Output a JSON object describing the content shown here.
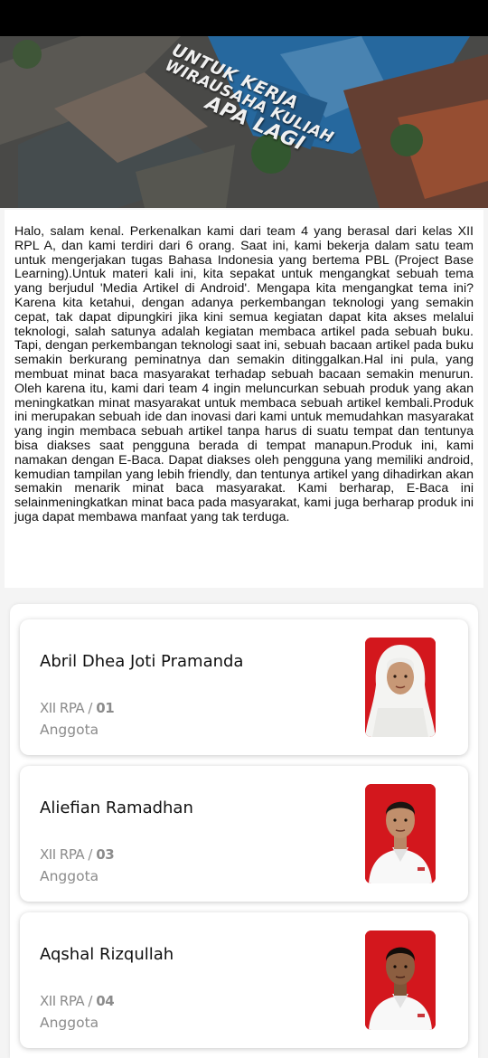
{
  "hero": {
    "line1": "UNTUK KERJA",
    "line2": "WIRAUSAHA   KULIAH",
    "line3": "APA LAGI"
  },
  "intro": {
    "text": "Halo, salam kenal. Perkenalkan kami dari team 4 yang berasal dari kelas XII RPL A, dan kami terdiri dari 6 orang. Saat ini, kami bekerja dalam satu team untuk mengerjakan tugas Bahasa Indonesia yang bertema PBL (Project Base Learning).Untuk materi kali ini, kita sepakat untuk mengangkat sebuah tema yang berjudul 'Media Artikel di Android'. Mengapa kita mengangkat tema ini? Karena kita ketahui, dengan adanya perkembangan teknologi yang semakin cepat, tak dapat dipungkiri jika kini semua kegiatan dapat kita akses melalui teknologi, salah satunya adalah kegiatan membaca artikel pada sebuah buku. Tapi, dengan perkembangan teknologi saat ini, sebuah bacaan artikel pada buku semakin berkurang peminatnya dan semakin ditinggalkan.Hal ini pula, yang membuat minat baca masyarakat terhadap sebuah bacaan semakin menurun. Oleh karena itu, kami dari team 4 ingin meluncurkan sebuah produk yang akan meningkatkan minat masyarakat untuk membaca sebuah artikel kembali.Produk ini merupakan sebuah ide dan inovasi dari kami untuk memudahkan masyarakat yang ingin membaca sebuah artikel tanpa harus di suatu tempat dan tentunya bisa diakses saat pengguna berada di tempat manapun.Produk ini, kami namakan dengan E-Baca. Dapat diakses oleh pengguna yang memiliki android, kemudian tampilan yang lebih friendly, dan tentunya artikel yang dihadirkan akan semakin menarik minat baca masyarakat. Kami berharap, E-Baca ini selainmeningkatkan minat baca pada masyarakat, kami juga berharap produk ini juga dapat membawa manfaat yang tak terduga."
  },
  "members": [
    {
      "name": "Abril Dhea Joti Pramanda",
      "class_label": "XII RPA / ",
      "number": "01",
      "role": "Anggota",
      "photo": "member-photo-hijab"
    },
    {
      "name": "Aliefian Ramadhan",
      "class_label": "XII RPA / ",
      "number": "03",
      "role": "Anggota",
      "photo": "member-photo-male"
    },
    {
      "name": "Aqshal Rizqullah",
      "class_label": "XII RPA / ",
      "number": "04",
      "role": "Anggota",
      "photo": "member-photo-male"
    }
  ],
  "colors": {
    "photo_background": "#d3171d",
    "secondary_text": "#8c8c8c"
  }
}
